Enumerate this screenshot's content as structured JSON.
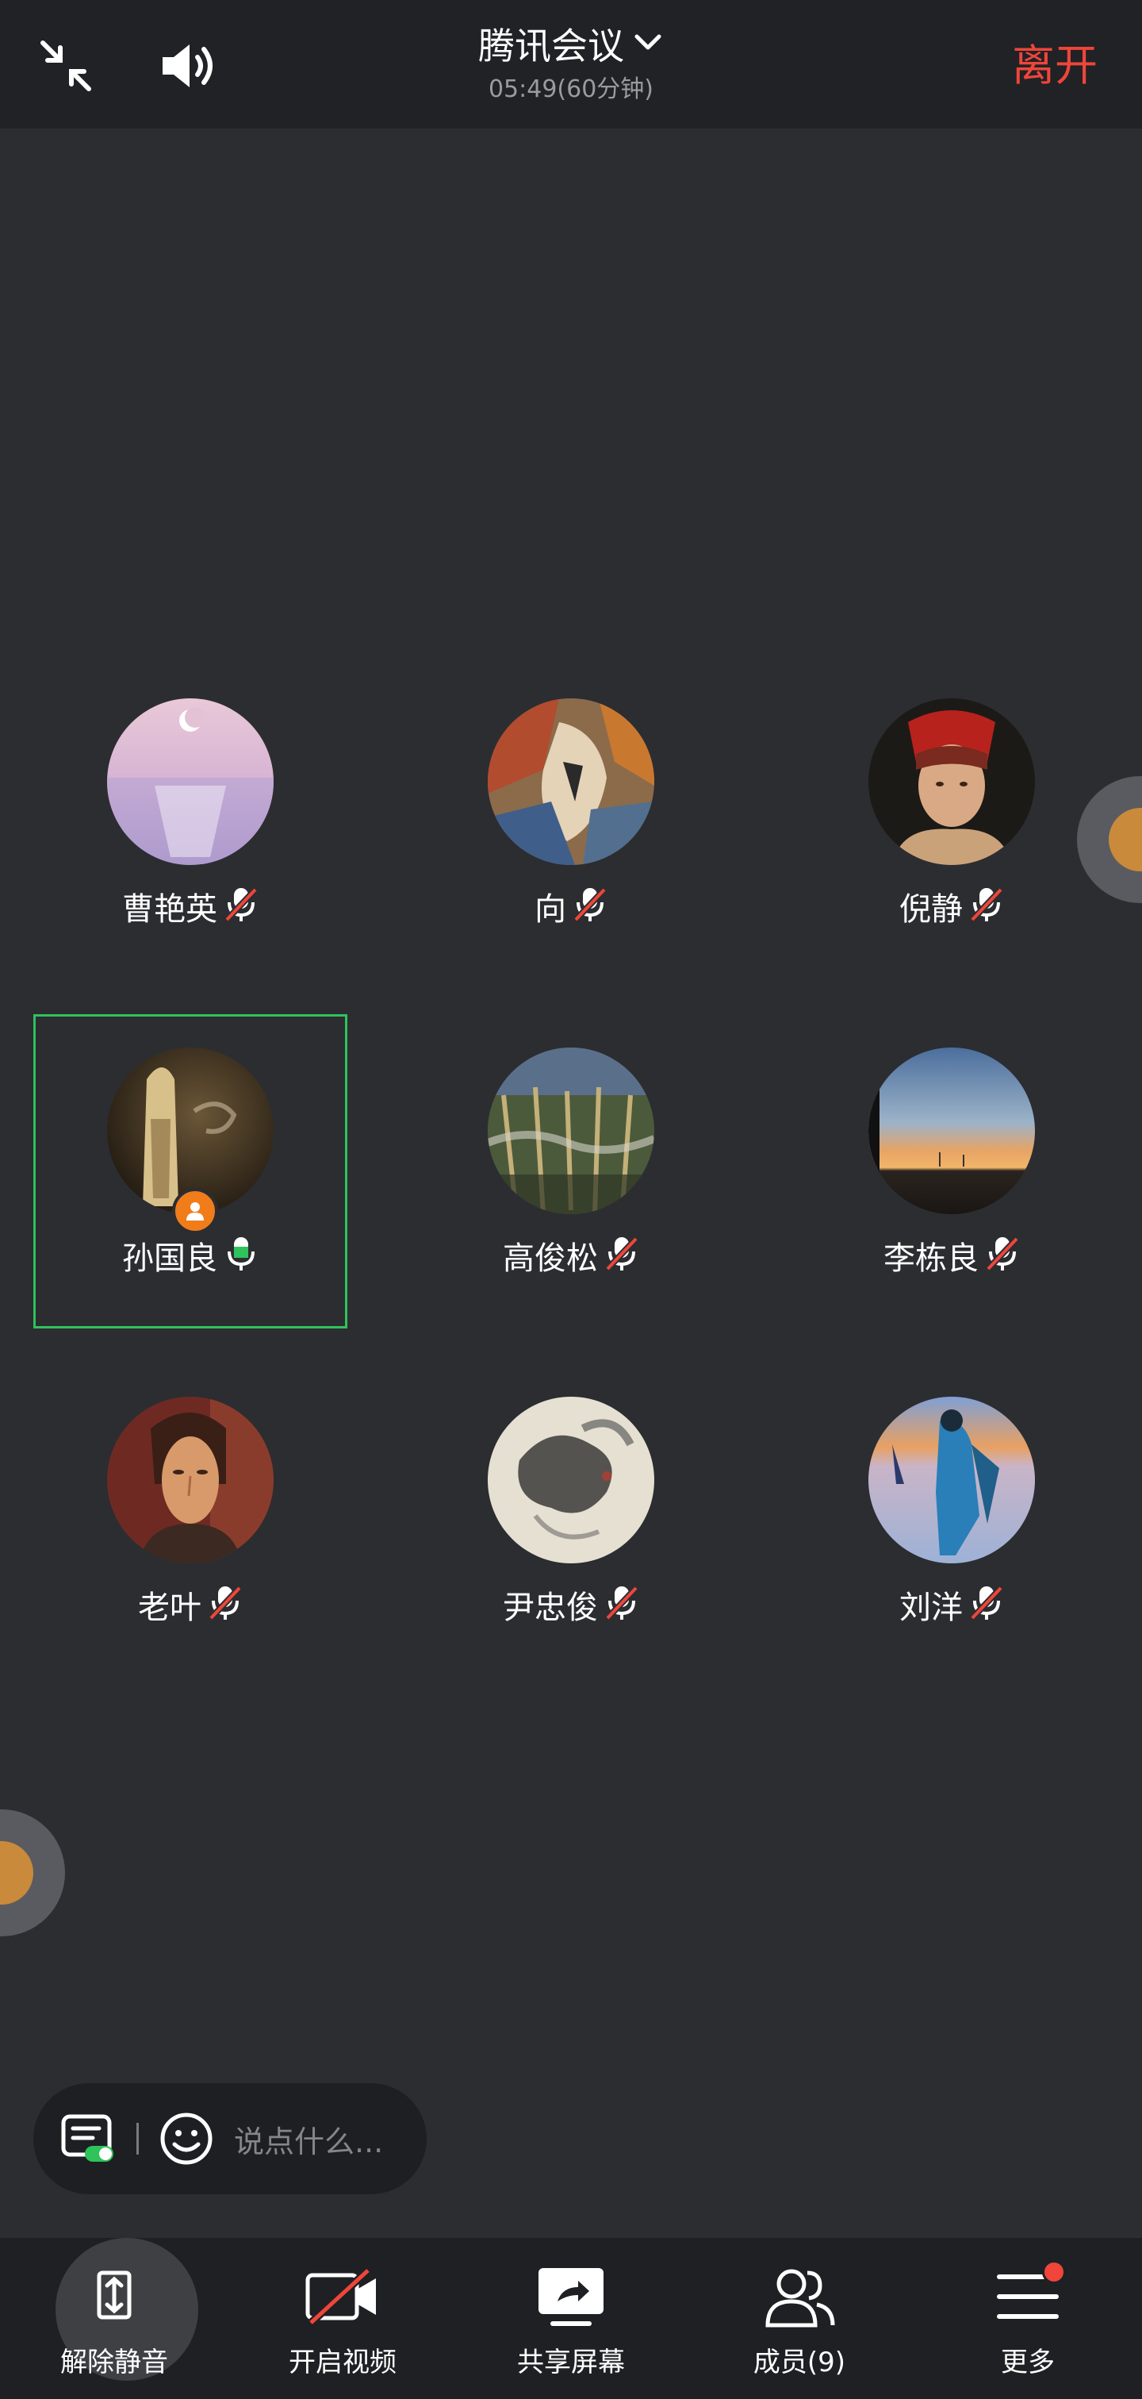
{
  "header": {
    "title": "腾讯会议",
    "subtitle": "05:49(60分钟)",
    "leave_label": "离开"
  },
  "participants": [
    {
      "name": "曹艳英",
      "mic": "muted",
      "avatar": "pink-sea-moon"
    },
    {
      "name": "向",
      "mic": "muted",
      "avatar": "abstract-paint"
    },
    {
      "name": "倪静",
      "mic": "muted",
      "avatar": "red-headscarf-portrait"
    },
    {
      "name": "孙国良",
      "mic": "speaking",
      "avatar": "dim-statue",
      "is_host": true
    },
    {
      "name": "高俊松",
      "mic": "muted",
      "avatar": "crowd-scene"
    },
    {
      "name": "李栋良",
      "mic": "muted",
      "avatar": "sunset-horizon"
    },
    {
      "name": "老叶",
      "mic": "muted",
      "avatar": "modigliani-portrait"
    },
    {
      "name": "尹忠俊",
      "mic": "muted",
      "avatar": "ink-wash"
    },
    {
      "name": "刘洋",
      "mic": "muted",
      "avatar": "blue-figure-beach"
    }
  ],
  "chat": {
    "placeholder": "说点什么..."
  },
  "toolbar": {
    "unmute_label": "解除静音",
    "video_label": "开启视频",
    "share_label": "共享屏幕",
    "members_label": "成员(9)",
    "more_label": "更多"
  },
  "colors": {
    "background": "#2c2d31",
    "topbar": "#212225",
    "toolbar": "#1f2023",
    "leave_red": "#f0453a",
    "speaking_green": "#2ec35b",
    "host_orange": "#f07c1a"
  },
  "icons": {
    "collapse": "collapse-arrows-icon",
    "speaker": "speaker-icon",
    "title_dropdown": "chevron-down-icon",
    "mic_muted": "mic-muted-icon",
    "mic_active": "mic-active-icon",
    "host": "host-person-icon",
    "chat_list": "chat-list-icon",
    "emoji": "emoji-icon",
    "unmute": "mic-unmute-icon",
    "video_off": "video-off-icon",
    "share_screen": "share-screen-icon",
    "members": "members-icon",
    "more": "menu-icon"
  }
}
